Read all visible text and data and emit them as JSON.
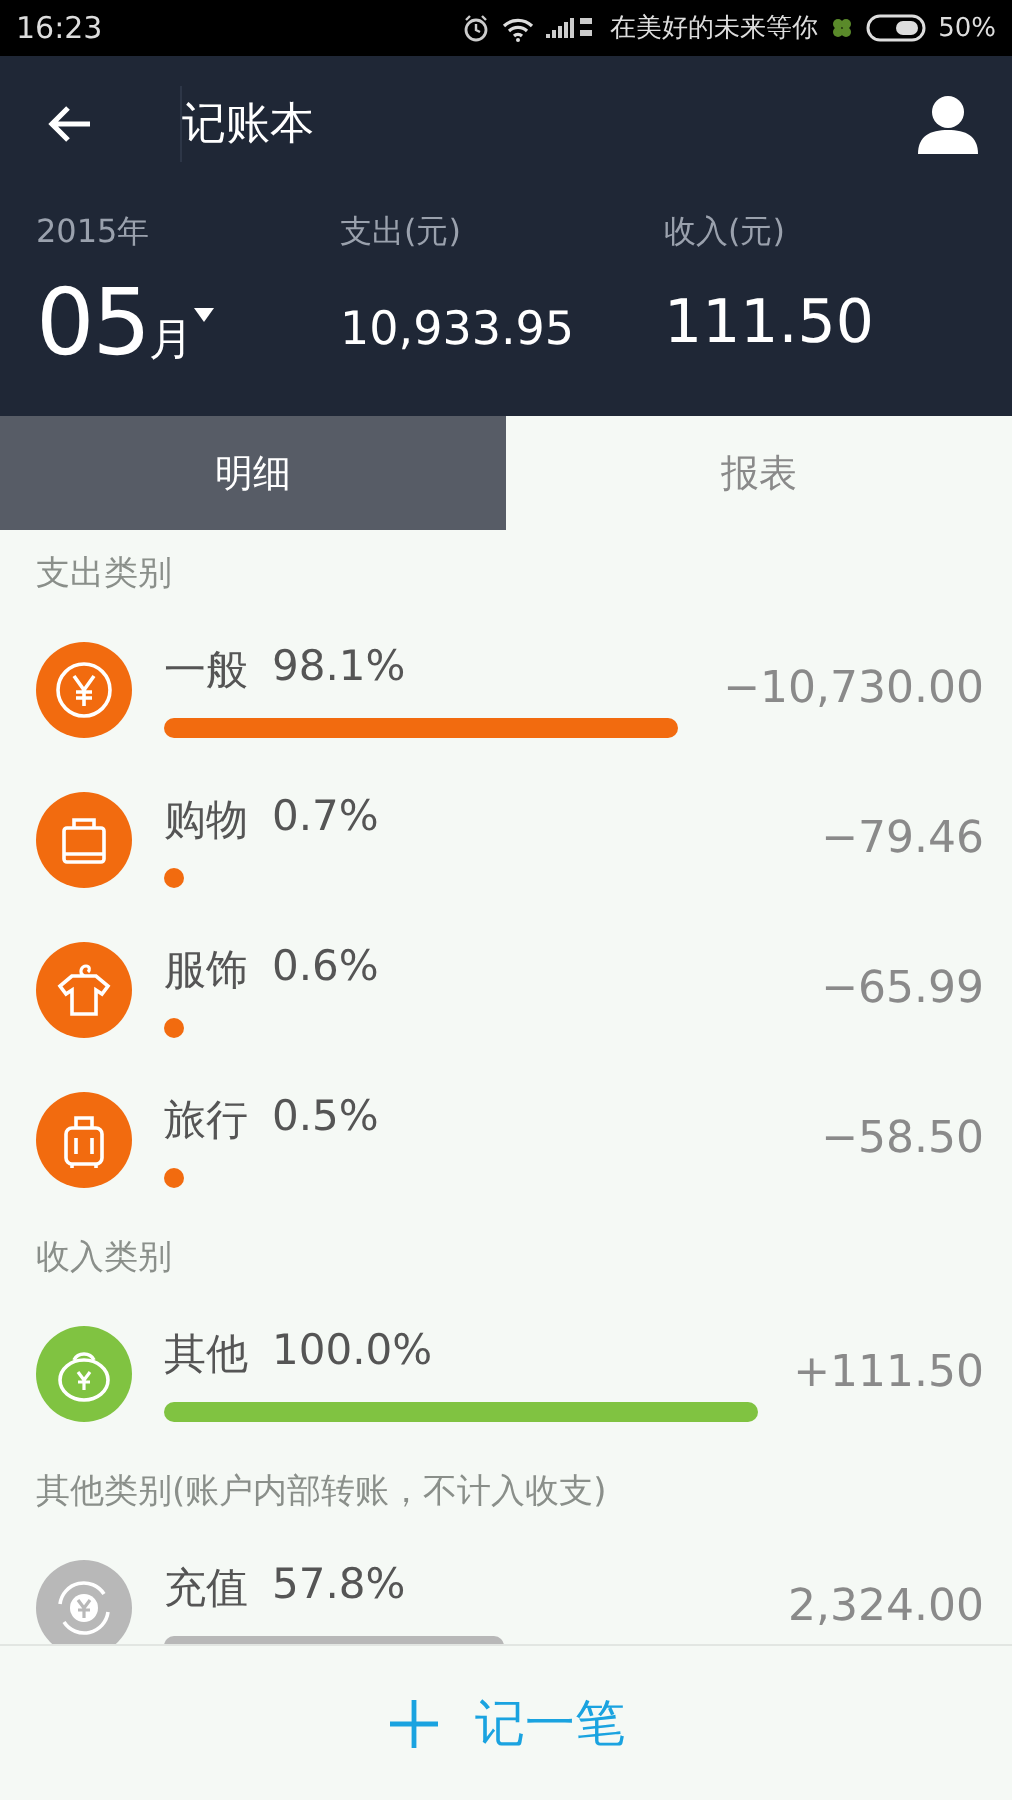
{
  "status_bar": {
    "time": "16:23",
    "carrier": "在美好的未来等你",
    "battery": "50%"
  },
  "app_bar": {
    "title": "记账本"
  },
  "summary": {
    "year": "2015年",
    "month": "05",
    "month_unit": "月",
    "expense_label": "支出(元)",
    "expense": "10,933.95",
    "income_label": "收入(元)",
    "income": "111.50"
  },
  "tabs": [
    {
      "label": "明细",
      "selected": true
    },
    {
      "label": "报表",
      "selected": false
    }
  ],
  "sections": [
    {
      "title": "支出类别",
      "items": [
        {
          "kind": "yen",
          "name": "一般",
          "percent": "98.1%",
          "amount": "−10,730.00",
          "color": "#f26b0f"
        },
        {
          "kind": "bag",
          "name": "购物",
          "percent": "0.7%",
          "amount": "−79.46",
          "color": "#f26b0f"
        },
        {
          "kind": "shirt",
          "name": "服饰",
          "percent": "0.6%",
          "amount": "−65.99",
          "color": "#f26b0f"
        },
        {
          "kind": "luggage",
          "name": "旅行",
          "percent": "0.5%",
          "amount": "−58.50",
          "color": "#f26b0f"
        }
      ]
    },
    {
      "title": "收入类别",
      "items": [
        {
          "kind": "moneybag",
          "name": "其他",
          "percent": "100.0%",
          "amount": "+111.50",
          "color": "#80c341"
        }
      ]
    },
    {
      "title": "其他类别(账户内部转账，不计入收支)",
      "items": [
        {
          "kind": "exchange",
          "name": "充值",
          "percent": "57.8%",
          "amount": "2,324.00",
          "color": "#b8b8b8"
        }
      ]
    }
  ],
  "add_button": {
    "label": "记一笔"
  }
}
